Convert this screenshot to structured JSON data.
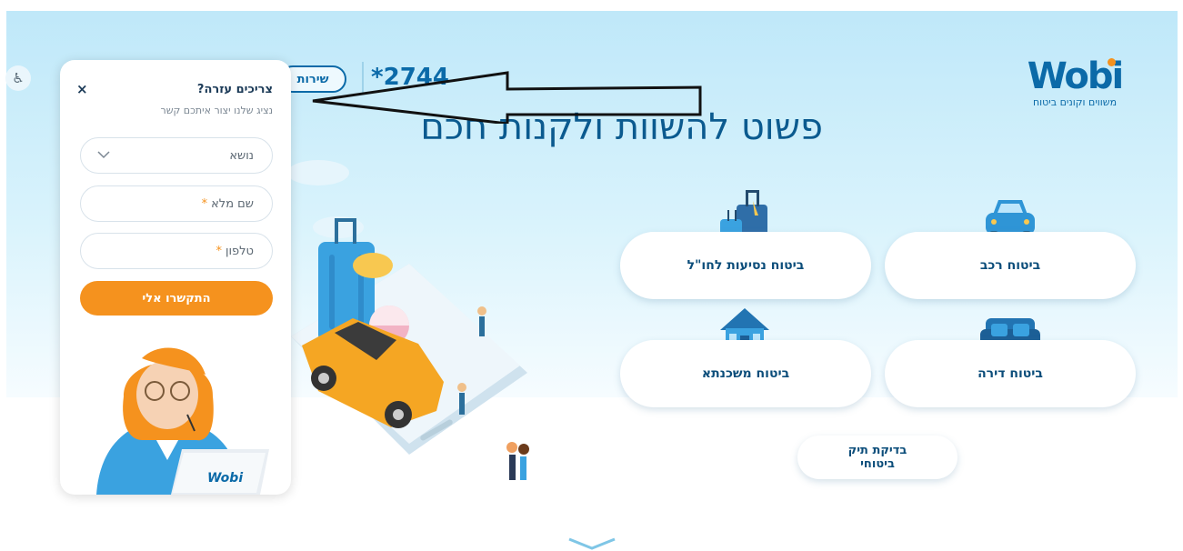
{
  "header": {
    "logo_text": "Wobi",
    "logo_tagline": "משווים וקונים ביטוח",
    "phone": "*2744",
    "service_label": "שירות",
    "accessibility_icon": "wheelchair-icon"
  },
  "hero": {
    "headline": "פשוט להשוות ולקנות חכם"
  },
  "insurance": {
    "car": "ביטוח רכב",
    "travel": "ביטוח נסיעות לחו\"ל",
    "apartment": "ביטוח דירה",
    "mortgage": "ביטוח משכנתא",
    "portfolio": "בדיקת תיק ביטוחי"
  },
  "help_panel": {
    "title": "צריכים עזרה?",
    "subtitle": "נציג שלנו יצור איתכם קשר",
    "close": "×",
    "topic_placeholder": "נושא",
    "name_placeholder": "שם מלא",
    "phone_placeholder": "טלפון",
    "required_mark": "*",
    "submit": "התקשרו אלי",
    "laptop_logo": "Wobi"
  },
  "colors": {
    "brand_blue": "#0b6aa8",
    "accent_orange": "#f5921e",
    "sky": "#bfe8f9"
  }
}
